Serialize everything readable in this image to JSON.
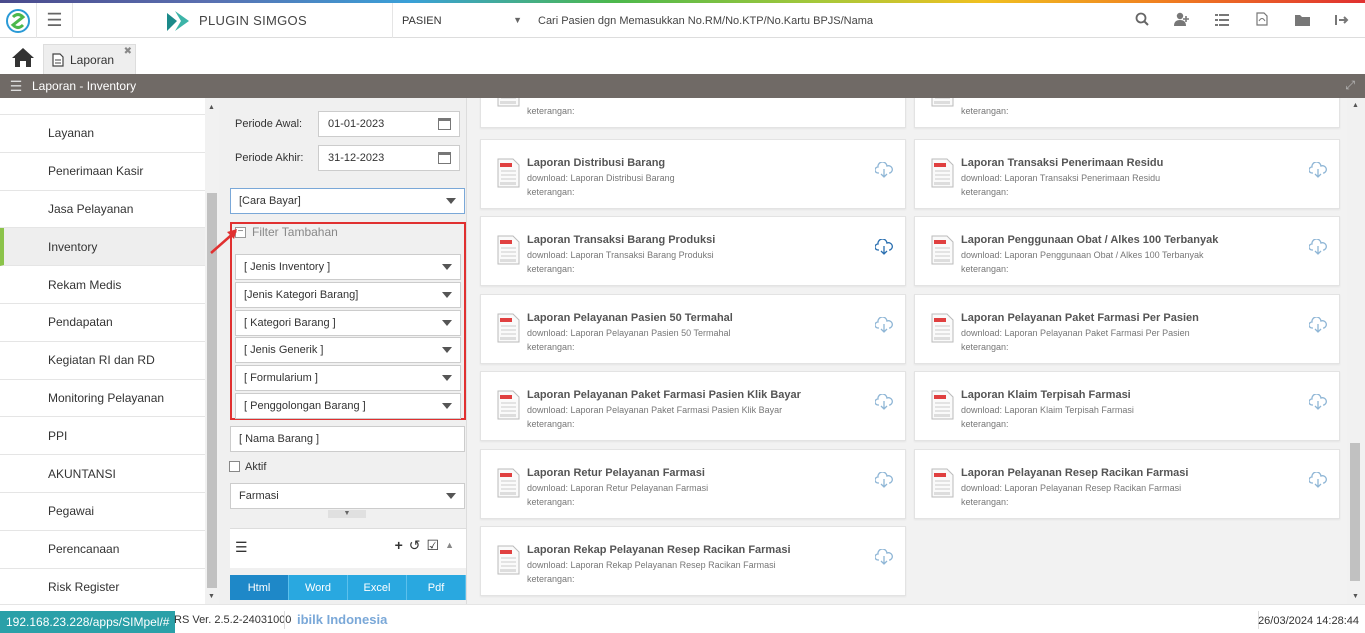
{
  "app": {
    "brand": "PLUGIN SIMGOS"
  },
  "header": {
    "patient_select": "PASIEN",
    "search_placeholder": "Cari Pasien dgn Memasukkan No.RM/No.KTP/No.Kartu BPJS/Nama",
    "icons": [
      "search-icon",
      "user-plus-icon",
      "list-icon",
      "pdf-icon",
      "folder-icon",
      "logout-icon"
    ]
  },
  "tabs": [
    {
      "label": "Laporan"
    }
  ],
  "panel": {
    "title": "Laporan - Inventory"
  },
  "sidebar": {
    "items": [
      {
        "label": "Layanan"
      },
      {
        "label": "Penerimaan Kasir"
      },
      {
        "label": "Jasa Pelayanan"
      },
      {
        "label": "Inventory",
        "active": true
      },
      {
        "label": "Rekam Medis"
      },
      {
        "label": "Pendapatan"
      },
      {
        "label": "Kegiatan RI dan RD"
      },
      {
        "label": "Monitoring Pelayanan"
      },
      {
        "label": "PPI"
      },
      {
        "label": "AKUNTANSI"
      },
      {
        "label": "Pegawai"
      },
      {
        "label": "Perencanaan"
      },
      {
        "label": "Risk Register"
      }
    ]
  },
  "filters": {
    "periode_awal_label": "Periode Awal:",
    "periode_awal": "01-01-2023",
    "periode_akhir_label": "Periode Akhir:",
    "periode_akhir": "31-12-2023",
    "cara_bayar": "[Cara Bayar]",
    "filter_tambahan": "Filter Tambahan",
    "extra": [
      "[ Jenis Inventory ]",
      "[Jenis Kategori Barang]",
      "[ Kategori Barang ]",
      "[ Jenis Generik ]",
      "[ Formularium ]",
      "[ Penggolongan Barang ]"
    ],
    "nama_barang": "[ Nama Barang ]",
    "aktif_label": "Aktif",
    "ruangan": "Farmasi",
    "export": [
      "Html",
      "Word",
      "Excel",
      "Pdf"
    ]
  },
  "reports": {
    "ket_label": "keterangan:",
    "items": [
      {
        "title": "",
        "download": ""
      },
      {
        "title": "",
        "download": ""
      },
      {
        "title": "Laporan Distribusi Barang",
        "download": "download: Laporan Distribusi Barang"
      },
      {
        "title": "Laporan Transaksi Penerimaan Residu",
        "download": "download: Laporan Transaksi Penerimaan Residu"
      },
      {
        "title": "Laporan Transaksi Barang Produksi",
        "download": "download: Laporan Transaksi Barang Produksi"
      },
      {
        "title": "Laporan Penggunaan Obat / Alkes 100 Terbanyak",
        "download": "download: Laporan Penggunaan Obat / Alkes 100 Terbanyak"
      },
      {
        "title": "Laporan Pelayanan Pasien 50 Termahal",
        "download": "download: Laporan Pelayanan Pasien 50 Termahal"
      },
      {
        "title": "Laporan Pelayanan Paket Farmasi Per Pasien",
        "download": "download: Laporan Pelayanan Paket Farmasi Per Pasien"
      },
      {
        "title": "Laporan Pelayanan Paket Farmasi Pasien Klik Bayar",
        "download": "download: Laporan Pelayanan Paket Farmasi Pasien Klik Bayar"
      },
      {
        "title": "Laporan Klaim Terpisah Farmasi",
        "download": "download: Laporan Klaim Terpisah Farmasi"
      },
      {
        "title": "Laporan Retur Pelayanan Farmasi",
        "download": "download: Laporan Retur Pelayanan Farmasi"
      },
      {
        "title": "Laporan Pelayanan Resep Racikan Farmasi",
        "download": "download: Laporan Pelayanan Resep Racikan Farmasi"
      },
      {
        "title": "Laporan Rekap Pelayanan Resep Racikan Farmasi",
        "download": "download: Laporan Rekap Pelayanan Resep Racikan Farmasi"
      }
    ]
  },
  "footer": {
    "url": "192.168.23.228/apps/SIMpel/#",
    "version": "RS Ver. 2.5.2-24031000",
    "company": "ibilk Indonesia",
    "datetime": "26/03/2024 14:28:44"
  },
  "colors": {
    "accent": "#29a8e0",
    "active_marker": "#8bc34a",
    "highlight": "#e03030",
    "panelbar": "#706a66"
  }
}
